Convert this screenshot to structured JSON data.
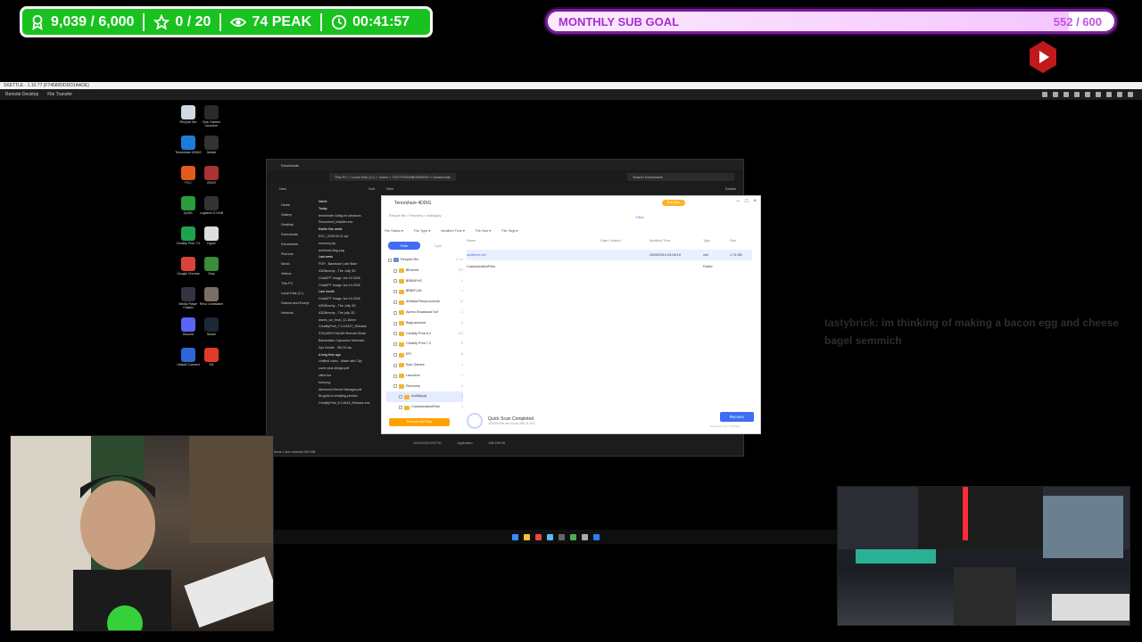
{
  "overlay": {
    "followers": "9,039 / 6,000",
    "stars": "0 / 20",
    "viewers": "74 PEAK",
    "timer": "00:41:57",
    "goal_label": "MONTHLY SUB GOAL",
    "goal_count": "552 / 600",
    "goal_progress": 0.92,
    "accent": "#19c21e",
    "goal_color": "#a52fcf"
  },
  "remote": {
    "title": "SKETTLE - 1.10.77 (F74580DDDD1AADE)",
    "tabs": [
      "Remote Desktop",
      "File Transfer"
    ]
  },
  "desktop_icons": [
    "Recycle Bin",
    "Epic Games Launcher",
    "Tenorshare 4DDiG",
    "Medal",
    "PCC",
    "ASUS",
    "ZyXEL",
    "Logitech G HUB",
    "Creality Print 7.0",
    "Hyper",
    "Google Chrome",
    "Stop",
    "Media Player Classic",
    "Revo Uninstaller",
    "Discord",
    "Steam",
    "Ubisoft Connect",
    "EA"
  ],
  "explorer": {
    "tab": "Downloads",
    "path": [
      "This PC",
      "Local Disk (C:)",
      "Users",
      "TASTYRAINBOWBISH",
      "Downloads"
    ],
    "search": "Search Downloads",
    "toolbar": [
      "New",
      "Sort",
      "View",
      "Details"
    ],
    "nav": [
      "Home",
      "Gallery",
      "Desktop",
      "Downloads",
      "Documents",
      "Pictures",
      "Music",
      "Videos",
      "This PC",
      "Local Disk (C:)",
      "Games and Everyt",
      "Network"
    ],
    "files": [
      {
        "name": "Name",
        "grp": true
      },
      {
        "name": "Today",
        "grp": true
      },
      {
        "name": "tenorshare-4ddig-for-windows"
      },
      {
        "name": "Recovered_Installer.exe"
      },
      {
        "name": "Earlier this week",
        "grp": true
      },
      {
        "name": "RCC_2026.05.21.zip"
      },
      {
        "name": "recovery.zip"
      },
      {
        "name": "american-flag.png"
      },
      {
        "name": "Last week",
        "grp": true
      },
      {
        "name": "POP - Bambuke Lake Bam"
      },
      {
        "name": "#3DBenchy - The Jolly 3D"
      },
      {
        "name": "ChatGPT Image Jan 10 2026"
      },
      {
        "name": "ChatGPT Image Jan 10 2026"
      },
      {
        "name": "Last month",
        "grp": true
      },
      {
        "name": "ChatGPT Image Jan 10 2026"
      },
      {
        "name": "#3DBenchy - The Jolly 3D"
      },
      {
        "name": "#3DBenchy - The jolly 3D"
      },
      {
        "name": "dseek_scr_final_12-16mm"
      },
      {
        "name": "CrealityPrint_7.0.4.8127_Release"
      },
      {
        "name": "STALKER RADAR Remote Mode"
      },
      {
        "name": "Bambulabs Capuccino Mermaid"
      },
      {
        "name": "Syn Kende - 3D170.zip"
      },
      {
        "name": "A long time ago",
        "grp": true
      },
      {
        "name": "Untitled video - Made with Clip"
      },
      {
        "name": "cover plus design.pdf"
      },
      {
        "name": "client.lua"
      },
      {
        "name": "lock.png"
      },
      {
        "name": "Atkinson's Bench Manager.pdf"
      },
      {
        "name": "tbl-guild-lo-restyling-pinokio"
      },
      {
        "name": "CrealityPrint_6.3.8418_Release.exe"
      }
    ],
    "status": "Items  1 item selected  553 MB",
    "meta_row": {
      "date": "10/24/2025 3:05 PM",
      "type": "Application",
      "size": "538,198 KB"
    }
  },
  "ddig": {
    "title": "Tenorshare 4DDiG",
    "buy_now": "Buy Now",
    "crumb": "Recycle Bin  >  Recovery  >  AuthApply",
    "filter": "Filter",
    "filters": [
      "File Status",
      "File Type",
      "Modified Time",
      "File Size",
      "File Tags"
    ],
    "tabs": [
      "Path",
      "Type"
    ],
    "tree": [
      {
        "name": "Recycle Bin",
        "count": "27.1K"
      },
      {
        "name": "$Extend",
        "count": "879"
      },
      {
        "name": "$RBAFHG",
        "count": "5"
      },
      {
        "name": "$RBIFL3D",
        "count": "1"
      },
      {
        "name": "4DefaultTempLaunche",
        "count": "12"
      },
      {
        "name": "Aperio Broadcast Sof",
        "count": "1"
      },
      {
        "name": "BagLauncher",
        "count": "5"
      },
      {
        "name": "Creality Print 6.2",
        "count": "412"
      },
      {
        "name": "Creality Print 7.0",
        "count": "6"
      },
      {
        "name": "EFI",
        "count": "6"
      },
      {
        "name": "Epic Games",
        "count": "4"
      },
      {
        "name": "Launcher",
        "count": "1"
      },
      {
        "name": "Recovery",
        "count": "4"
      },
      {
        "name": "AuthApply",
        "count": "2",
        "sel": true
      },
      {
        "name": "CustomizationFiles",
        "count": "1"
      }
    ],
    "columns": [
      "Name",
      "Date Created",
      "Modified Time",
      "Type",
      "Size"
    ],
    "rows": [
      {
        "name": "unattend.xml",
        "created": "",
        "modified": "2025/09/14 04:06:19",
        "type": "xml",
        "size": "1.73 KB",
        "sel": true
      },
      {
        "name": "CustomizationFiles",
        "created": "",
        "modified": "",
        "type": "Folder",
        "size": ""
      }
    ],
    "recover_all": "Recover All Files",
    "scan_title": "Quick Scan Completed",
    "scan_sub": "152929 files are found (260.11 GB)",
    "recover": "Recover",
    "selected_note": "Selected: 0 file, 0.00 Byte"
  },
  "chat": {
    "user": "tastybrick:",
    "message": "im thinking of making a bacon egg and cheese bagel semmich"
  }
}
